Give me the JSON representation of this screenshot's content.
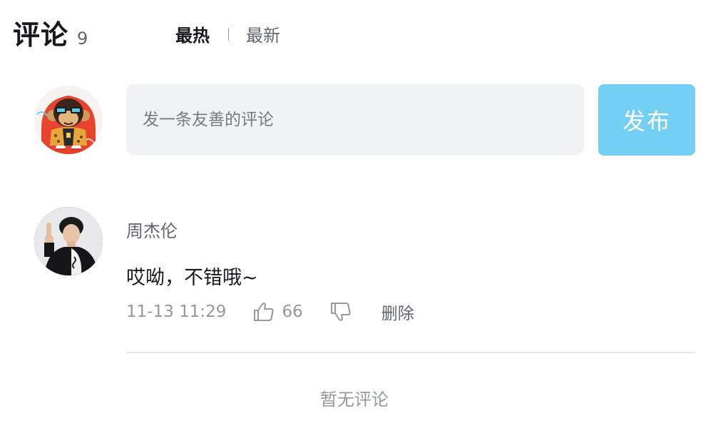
{
  "header": {
    "title": "评论",
    "count": "9",
    "sort_hot": "最热",
    "sort_new": "最新"
  },
  "reply": {
    "placeholder": "发一条友善的评论",
    "send_label": "发布"
  },
  "comment": {
    "username": "周杰伦",
    "content": "哎呦，不错哦~",
    "time": "11-13 11:29",
    "like_count": "66",
    "delete_label": "删除"
  },
  "footer": {
    "empty_text": "暂无评论"
  },
  "colors": {
    "accent": "#73cff3",
    "text_primary": "#18191c",
    "text_secondary": "#61666d",
    "text_tertiary": "#9499a0",
    "input_bg": "#f1f2f3",
    "divider": "#e3e5e7"
  },
  "icons": {
    "like": "thumbs-up-icon",
    "dislike": "thumbs-down-icon"
  }
}
